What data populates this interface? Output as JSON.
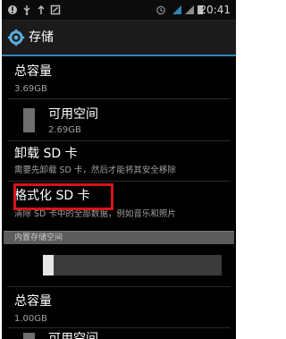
{
  "status_bar": {
    "time": "20:41"
  },
  "action_bar": {
    "icon": "settings-gear-icon",
    "title": "存储"
  },
  "storage_internal_sd": {
    "total_label": "总容量",
    "total_value": "3.69GB",
    "available_label": "可用空间",
    "available_value": "2.69GB",
    "unmount_label": "卸载 SD 卡",
    "unmount_desc": "需要先卸载 SD 卡，然后才能将其安全移除",
    "format_label": "格式化 SD 卡",
    "format_desc": "清除 SD 卡中的全部数据，例如音乐和照片"
  },
  "section_internal": {
    "header": "内置存储空间",
    "usage_fraction": 0.06,
    "total_label": "总容量",
    "total_value": "1.00GB",
    "partial_label": "可用空间"
  },
  "colors": {
    "accent": "#2f86b8",
    "highlight": "#d6141a"
  }
}
